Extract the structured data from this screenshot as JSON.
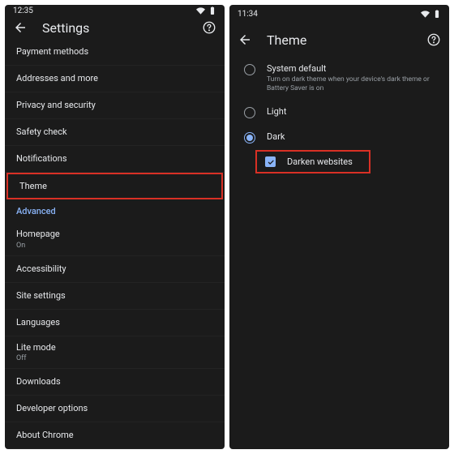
{
  "left": {
    "status_time": "12:35",
    "title": "Settings",
    "items": [
      {
        "label": "Payment methods"
      },
      {
        "label": "Addresses and more"
      },
      {
        "label": "Privacy and security"
      },
      {
        "label": "Safety check"
      },
      {
        "label": "Notifications"
      },
      {
        "label": "Theme",
        "highlighted": true
      },
      {
        "label": "Advanced",
        "section": true
      },
      {
        "label": "Homepage",
        "sub": "On"
      },
      {
        "label": "Accessibility"
      },
      {
        "label": "Site settings"
      },
      {
        "label": "Languages"
      },
      {
        "label": "Lite mode",
        "sub": "Off"
      },
      {
        "label": "Downloads"
      },
      {
        "label": "Developer options"
      },
      {
        "label": "About Chrome"
      }
    ]
  },
  "right": {
    "status_time": "11:34",
    "title": "Theme",
    "options": [
      {
        "label": "System default",
        "desc": "Turn on dark theme when your device's dark theme or Battery Saver is on",
        "selected": false
      },
      {
        "label": "Light",
        "selected": false
      },
      {
        "label": "Dark",
        "selected": true
      }
    ],
    "checkbox": {
      "label": "Darken websites",
      "checked": true,
      "highlighted": true
    }
  },
  "icons": {
    "wifi": "wifi-icon",
    "battery": "battery-icon",
    "back": "back-arrow-icon",
    "help": "help-icon",
    "check": "check-icon"
  }
}
